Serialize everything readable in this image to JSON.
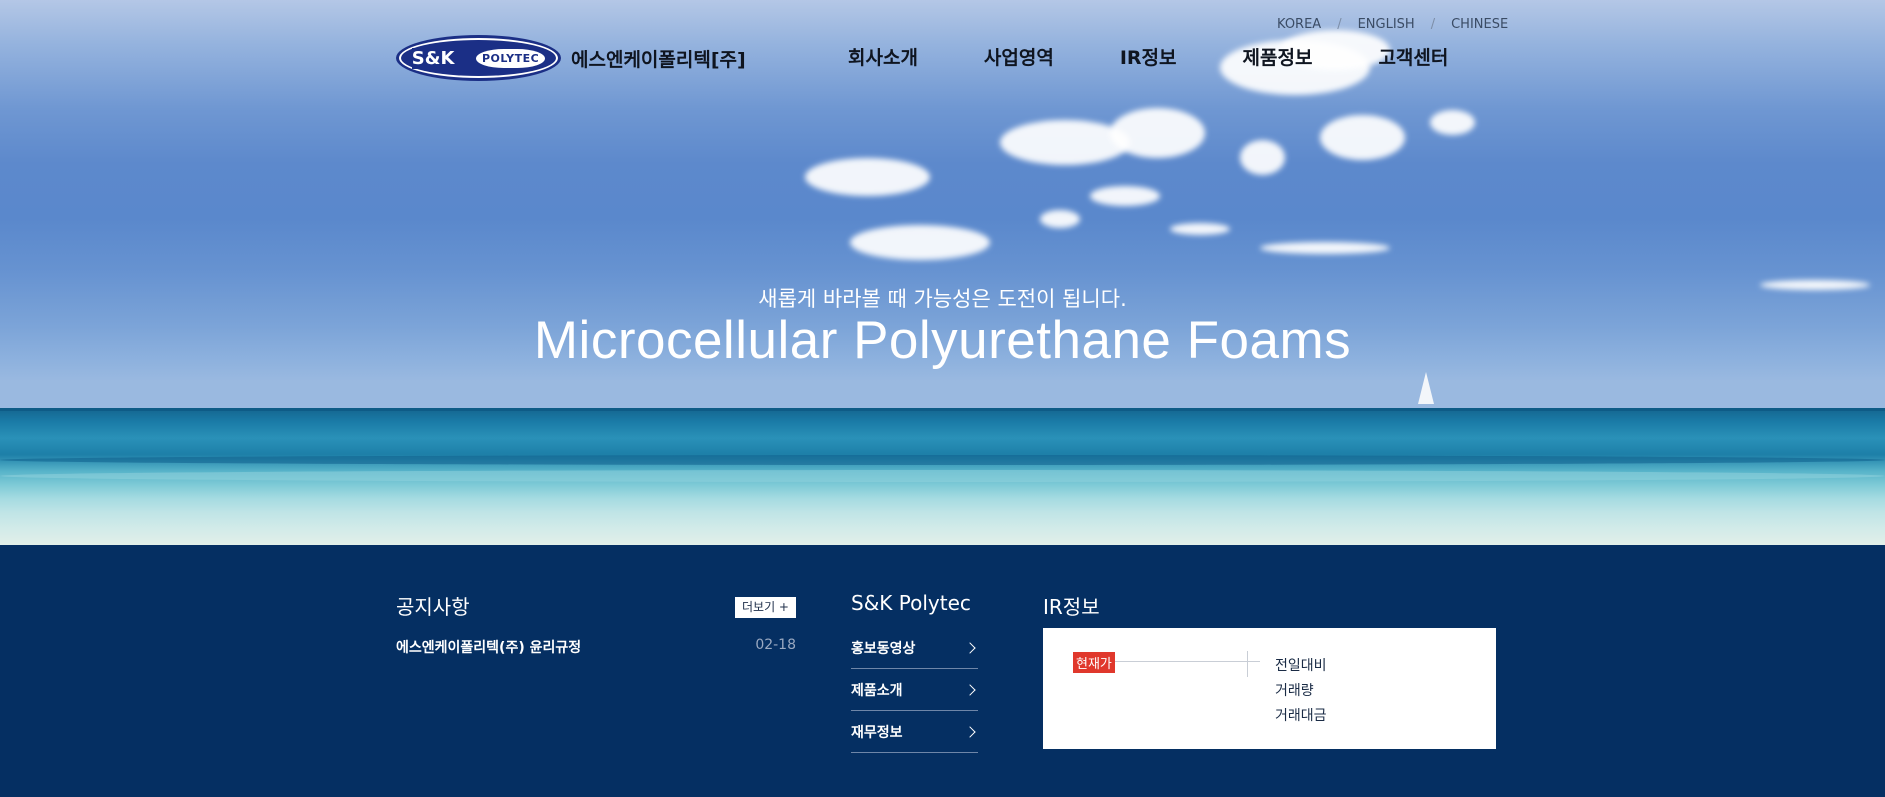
{
  "header": {
    "languages": [
      "KOREA",
      "ENGLISH",
      "CHINESE"
    ],
    "logo": {
      "mark_left": "S&K",
      "mark_right": "POLYTEC",
      "company_name": "에스엔케이폴리텍[주]"
    },
    "nav": [
      "회사소개",
      "사업영역",
      "IR정보",
      "제품정보",
      "고객센터"
    ]
  },
  "hero": {
    "subtitle": "새롭게 바라볼 때 가능성은 도전이 됩니다.",
    "title": "Microcellular Polyurethane Foams"
  },
  "notice": {
    "heading": "공지사항",
    "more_label": "더보기 +",
    "items": [
      {
        "title": "에스엔케이폴리텍(주) 윤리규정",
        "date": "02-18"
      }
    ]
  },
  "company_links": {
    "heading": "S&K Polytec",
    "items": [
      "홍보동영상",
      "제품소개",
      "재무정보"
    ]
  },
  "ir": {
    "heading": "IR정보",
    "current_price_label": "현재가",
    "metrics": [
      "전일대비",
      "거래량",
      "거래대금"
    ]
  },
  "colors": {
    "footer_bg": "#052f62",
    "badge_red": "#e0382c",
    "logo_navy": "#1b2f86"
  }
}
